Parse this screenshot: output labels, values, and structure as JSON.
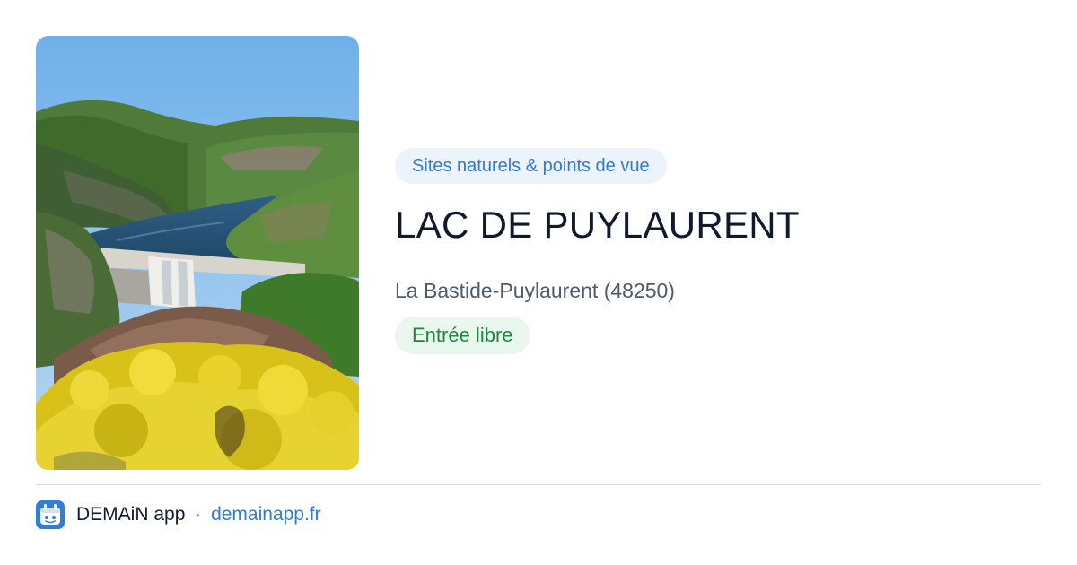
{
  "card": {
    "image_alt": "Lac de Puylaurent — barrage et genêts en fleurs",
    "category": "Sites naturels & points de vue",
    "title": "LAC DE PUYLAURENT",
    "location": "La Bastide-Puylaurent (48250)",
    "access_badge": "Entrée libre"
  },
  "footer": {
    "app_icon": "app-logo-icon",
    "app_name": "DEMAiN app",
    "separator": "·",
    "site_url": "demainapp.fr"
  },
  "colors": {
    "category_bg": "#edf3fb",
    "category_text": "#2e7bd0",
    "badge_bg": "#eaf7ee",
    "badge_text": "#1e8a3c",
    "title_text": "#111a2c",
    "link": "#2e7bd0"
  }
}
